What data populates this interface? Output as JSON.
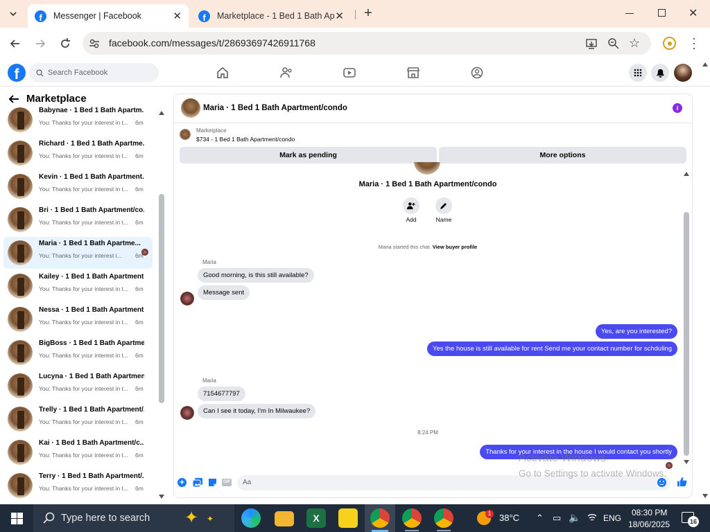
{
  "browser": {
    "tabs": [
      {
        "title": "Messenger | Facebook",
        "active": true
      },
      {
        "title": "Marketplace - 1 Bed 1 Bath Apa",
        "active": false
      }
    ],
    "url": "facebook.com/messages/t/28693697426911768"
  },
  "facebook": {
    "search_placeholder": "Search Facebook",
    "brand_color": "#1877f2"
  },
  "sidebar": {
    "title": "Marketplace",
    "conversations": [
      {
        "name": "Babynae · 1 Bed 1 Bath Apartm...",
        "preview": "You: Thanks for your interest in t...",
        "time": "6m"
      },
      {
        "name": "Richard · 1 Bed 1 Bath Apartme...",
        "preview": "You: Thanks for your interest in t...",
        "time": "6m"
      },
      {
        "name": "Kevin · 1 Bed 1 Bath Apartment...",
        "preview": "You: Thanks for your interest in t...",
        "time": "6m"
      },
      {
        "name": "Bri · 1 Bed 1 Bath Apartment/co...",
        "preview": "You: Thanks for your interest in t...",
        "time": "6m"
      },
      {
        "name": "Maria · 1 Bed 1 Bath Apartme...",
        "preview": "You: Thanks for your interest i...",
        "time": "6m",
        "selected": true
      },
      {
        "name": "Kailey · 1 Bed 1 Bath Apartment...",
        "preview": "You: Thanks for your interest in t...",
        "time": "6m"
      },
      {
        "name": "Nessa · 1 Bed 1 Bath Apartment...",
        "preview": "You: Thanks for your interest in t...",
        "time": "6m"
      },
      {
        "name": "BigBoss · 1 Bed 1 Bath Apartme...",
        "preview": "You: Thanks for your interest in t...",
        "time": "6m"
      },
      {
        "name": "Lucyna · 1 Bed 1 Bath Apartmen...",
        "preview": "You: Thanks for your interest in t...",
        "time": "6m"
      },
      {
        "name": "Trelly · 1 Bed 1 Bath Apartment/...",
        "preview": "You: Thanks for your interest in t...",
        "time": "6m"
      },
      {
        "name": "Kai · 1 Bed 1 Bath Apartment/c...",
        "preview": "You: Thanks for your interest in t...",
        "time": "6m"
      },
      {
        "name": "Terry · 1 Bed 1 Bath Apartment/...",
        "preview": "You: Thanks for your interest in t...",
        "time": "6m"
      }
    ]
  },
  "chat": {
    "header_title": "Maria · 1 Bed 1 Bath Apartment/condo",
    "listing_source": "Marketplace",
    "listing_title": "$734 - 1 Bed 1 Bath Apartment/condo",
    "mark_pending": "Mark as pending",
    "more_options": "More options",
    "profile_name": "Maria · 1 Bed 1 Bath Apartment/condo",
    "action_add": "Add",
    "action_name": "Name",
    "started_text": "Maria started this chat.",
    "view_buyer": "View buyer profile",
    "sender_name": "Maria",
    "messages_in_1": [
      "Good morning, is this still available?",
      "Message sent"
    ],
    "messages_out_1": [
      "Yes, are you interested?",
      "Yes the house is still available for rent Send me your contact number for schduling"
    ],
    "messages_in_2": [
      "7154677797",
      "Can I see it today, I'm In Milwaukee?"
    ],
    "timestamp": "8:24 PM",
    "message_out_2": "Thanks for your interest in the house I would contact you shortly",
    "composer_placeholder": "Aa",
    "gif_label": "GIF",
    "outgoing_color": "#4a4af0"
  },
  "watermark": {
    "line1": "Activate Windows",
    "line2": "Go to Settings to activate Windows."
  },
  "taskbar": {
    "search_placeholder": "Type here to search",
    "weather_temp": "38°C",
    "weather_badge": "1",
    "language": "ENG",
    "time": "08:30 PM",
    "date": "18/06/2025",
    "notifications": "16"
  }
}
